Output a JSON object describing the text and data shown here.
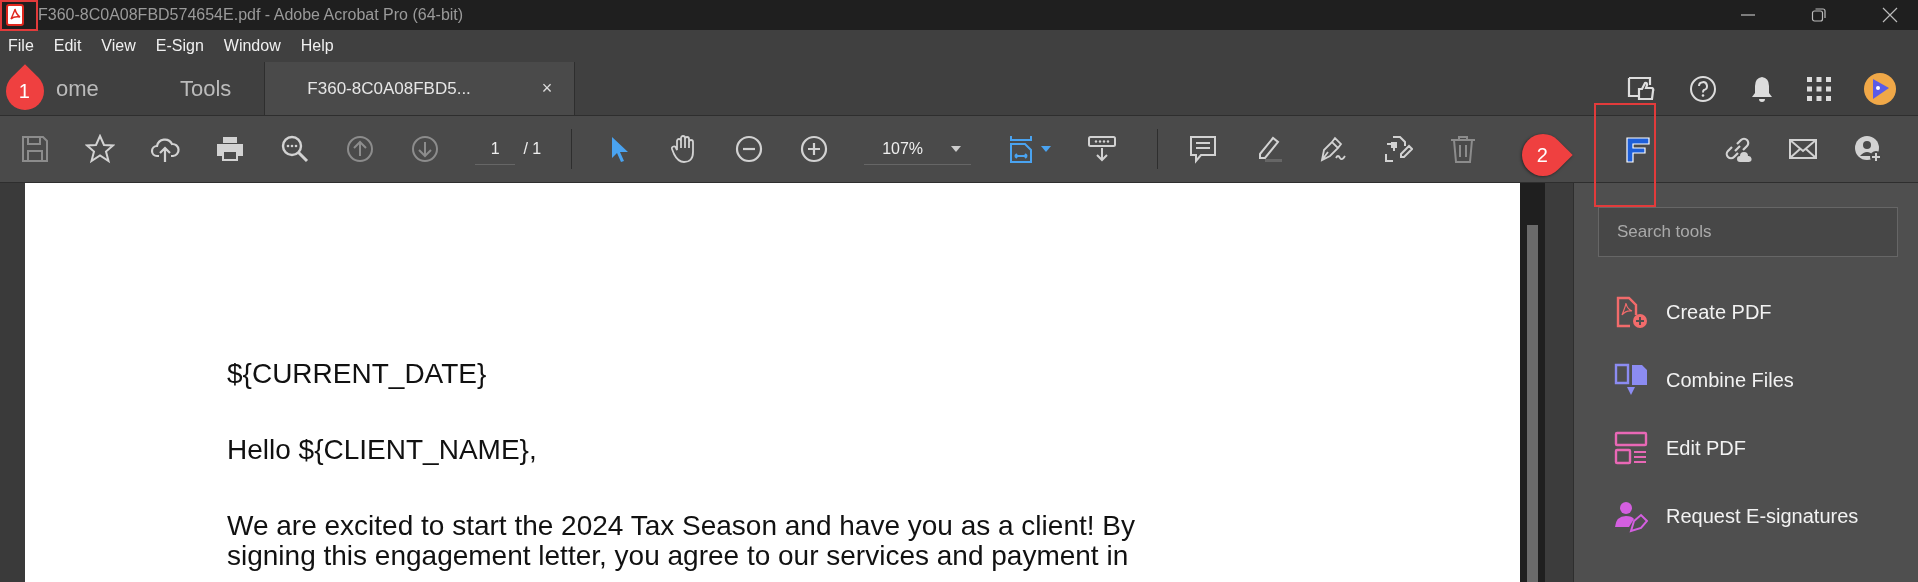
{
  "window": {
    "title": "F360-8C0A08FBD574654E.pdf - Adobe Acrobat Pro (64-bit)"
  },
  "menu": [
    "File",
    "Edit",
    "View",
    "E-Sign",
    "Window",
    "Help"
  ],
  "tabs": [
    {
      "label": "ome",
      "selected": false
    },
    {
      "label": "Tools",
      "selected": false
    },
    {
      "label": "F360-8C0A08FBD5...",
      "selected": true,
      "close": "×"
    }
  ],
  "toolbar": {
    "page_number": "1",
    "page_total": "/ 1",
    "zoom": "107%"
  },
  "document": {
    "paragraphs": [
      {
        "lines": [
          "${CURRENT_DATE}"
        ]
      },
      {
        "lines": [
          "Hello ${CLIENT_NAME},"
        ]
      },
      {
        "lines": [
          "We are excited to start the 2024 Tax Season and have you as a client! By",
          "signing this engagement letter, you agree to our services and payment in"
        ]
      }
    ]
  },
  "tools_panel": {
    "search": {
      "placeholder": "Search tools"
    },
    "items": [
      {
        "label": "Create PDF",
        "kind": "create",
        "color": "#f26b6b"
      },
      {
        "label": "Combine Files",
        "kind": "combine",
        "color": "#8c8cf2"
      },
      {
        "label": "Edit PDF",
        "kind": "edit",
        "color": "#e968b6"
      },
      {
        "label": "Request E-signatures",
        "kind": "sign",
        "color": "#d45fe0"
      }
    ]
  },
  "callouts": [
    {
      "number": "1"
    },
    {
      "number": "2"
    }
  ]
}
